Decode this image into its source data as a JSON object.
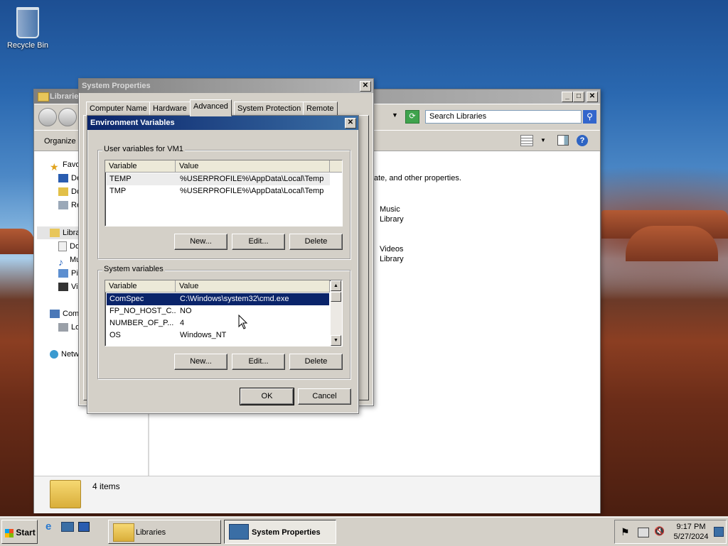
{
  "desktop": {
    "recycle_bin_label": "Recycle Bin"
  },
  "explorer": {
    "title": "Libraries",
    "search_placeholder": "Search Libraries",
    "organize_label": "Organize",
    "description_fragment": "ate, and other properties.",
    "nav": {
      "favorites": "Favo",
      "fav_items": [
        "De",
        "Do",
        "Re"
      ],
      "libraries": "Libra",
      "lib_items": [
        "Do",
        "Mu",
        "Pi",
        "Vi"
      ],
      "computer": "Com",
      "computer_items": [
        "Lo"
      ],
      "network": "Netw"
    },
    "libraries": [
      {
        "name": "Music",
        "type": "Library"
      },
      {
        "name": "Videos",
        "type": "Library"
      }
    ],
    "status_count": "4 items"
  },
  "system_properties": {
    "title": "System Properties",
    "tabs": [
      "Computer Name",
      "Hardware",
      "Advanced",
      "System Protection",
      "Remote"
    ],
    "selected_tab": "Advanced"
  },
  "env_vars": {
    "title": "Environment Variables",
    "user_group_label": "User variables for VM1",
    "system_group_label": "System variables",
    "col_variable": "Variable",
    "col_value": "Value",
    "user_rows": [
      {
        "variable": "TEMP",
        "value": "%USERPROFILE%\\AppData\\Local\\Temp"
      },
      {
        "variable": "TMP",
        "value": "%USERPROFILE%\\AppData\\Local\\Temp"
      }
    ],
    "system_rows": [
      {
        "variable": "ComSpec",
        "value": "C:\\Windows\\system32\\cmd.exe"
      },
      {
        "variable": "FP_NO_HOST_C...",
        "value": "NO"
      },
      {
        "variable": "NUMBER_OF_P...",
        "value": "4"
      },
      {
        "variable": "OS",
        "value": "Windows_NT"
      }
    ],
    "new_label": "New...",
    "edit_label": "Edit...",
    "delete_label": "Delete",
    "ok_label": "OK",
    "cancel_label": "Cancel"
  },
  "taskbar": {
    "start_label": "Start",
    "tasks": [
      {
        "label": "Libraries"
      },
      {
        "label": "System Properties"
      }
    ],
    "clock_time": "9:17 PM",
    "clock_date": "5/27/2024"
  },
  "colors": {
    "selection": "#0a246a",
    "dialog_face": "#d4d0c8",
    "active_title": "#0a246a"
  }
}
